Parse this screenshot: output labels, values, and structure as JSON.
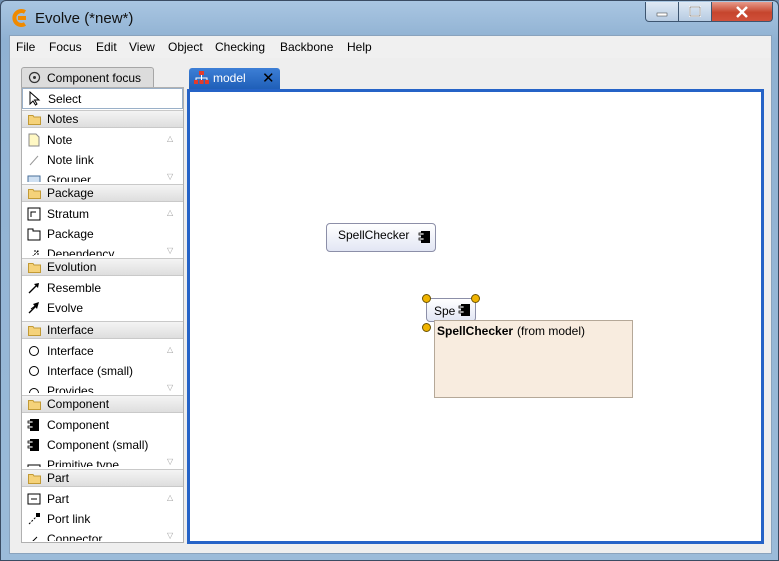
{
  "window": {
    "title": "Evolve (*new*)",
    "colors": {
      "accent": "#2563c7",
      "titlebar": "#a9c6e2",
      "close": "#c6452d"
    }
  },
  "menubar": {
    "items": [
      "File",
      "Focus",
      "Edit",
      "View",
      "Object",
      "Checking",
      "Backbone",
      "Help"
    ]
  },
  "palette": {
    "tab_label": "Component focus",
    "select_label": "Select",
    "drawers": [
      {
        "label": "Notes",
        "items": [
          "Note",
          "Note link",
          "Grouper"
        ]
      },
      {
        "label": "Package",
        "items": [
          "Stratum",
          "Package",
          "Dependency"
        ]
      },
      {
        "label": "Evolution",
        "items": [
          "Resemble",
          "Evolve"
        ]
      },
      {
        "label": "Interface",
        "items": [
          "Interface",
          "Interface (small)",
          "Provides"
        ]
      },
      {
        "label": "Component",
        "items": [
          "Component",
          "Component (small)",
          "Primitive type"
        ]
      },
      {
        "label": "Part",
        "items": [
          "Part",
          "Port link",
          "Connector"
        ]
      }
    ]
  },
  "editor": {
    "tab_label": "model",
    "tab_icon": "model-tree-icon",
    "components": [
      {
        "name": "SpellChecker"
      },
      {
        "name": "Spe"
      }
    ],
    "tooltip": {
      "name": "SpellChecker",
      "from": "(from model)"
    }
  }
}
